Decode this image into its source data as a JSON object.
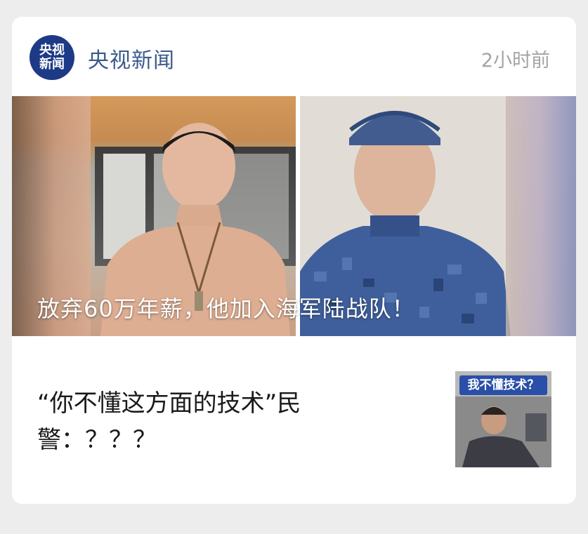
{
  "card": {
    "source": {
      "logo_text_line1": "央视",
      "logo_text_line2": "新闻",
      "name": "央视新闻"
    },
    "time": "2小时前",
    "hero": {
      "caption": "放弃60万年薪，他加入海军陆战队！"
    },
    "news_item": {
      "title": "“你不懂这方面的技术”民警：？？？",
      "thumbnail_label": "我不懂技术？"
    }
  },
  "colors": {
    "source_name": "#3a5a8c",
    "logo_bg": "#1d3a86",
    "timestamp": "#a4a4a4",
    "title_text": "#1a1a1a"
  }
}
